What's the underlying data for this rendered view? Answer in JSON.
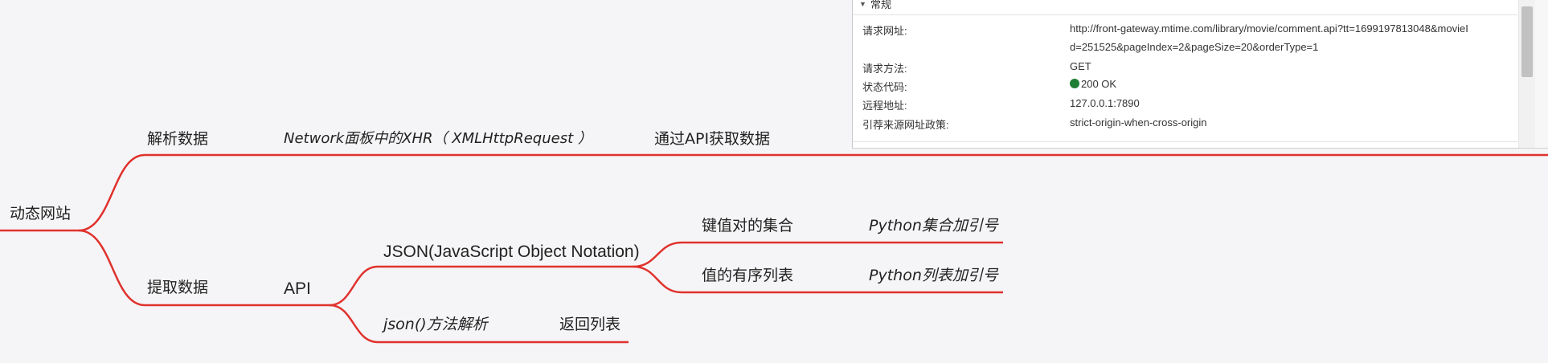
{
  "mindmap": {
    "root": "动态网站",
    "parse_branch": {
      "label": "解析数据",
      "network_xhr": "Network面板中的XHR（ XMLHttpRequest ）",
      "via_api": "通过API获取数据"
    },
    "extract_branch": {
      "label": "提取数据",
      "api": "API",
      "json": "JSON(JavaScript Object Notation)",
      "kv_set": "键值对的集合",
      "python_set": "Python集合加引号",
      "ordered_list": "值的有序列表",
      "python_list": "Python列表加引号",
      "json_method": "json()方法解析",
      "return_list": "返回列表"
    },
    "line_color": "#e0322d"
  },
  "devtools": {
    "section_title": "常规",
    "rows": [
      {
        "key": "请求网址:",
        "value": "http://front-gateway.mtime.com/library/movie/comment.api?tt=1699197813048&movieI"
      },
      {
        "key": "",
        "value": "d=251525&pageIndex=2&pageSize=20&orderType=1"
      },
      {
        "key": "请求方法:",
        "value": "GET"
      },
      {
        "key": "状态代码:",
        "value": "200 OK"
      },
      {
        "key": "远程地址:",
        "value": "127.0.0.1:7890"
      },
      {
        "key": "引荐来源网址政策:",
        "value": "strict-origin-when-cross-origin"
      }
    ],
    "status_color": "#1e7e34"
  }
}
